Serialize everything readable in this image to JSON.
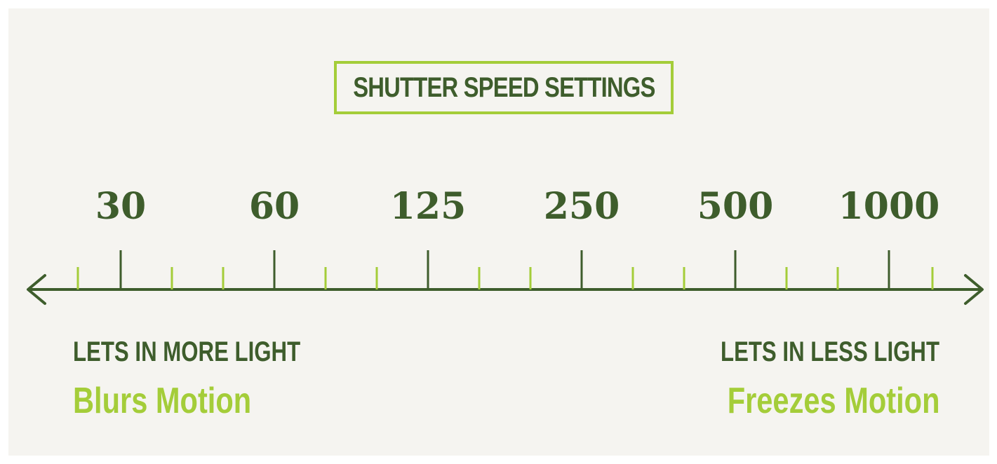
{
  "title": "SHUTTER SPEED SETTINGS",
  "scale": {
    "speeds": [
      "30",
      "60",
      "125",
      "250",
      "500",
      "1000"
    ],
    "minor_ticks_between": 2
  },
  "left_end": {
    "light": "LETS IN MORE LIGHT",
    "motion": "Blurs Motion"
  },
  "right_end": {
    "light": "LETS IN LESS LIGHT",
    "motion": "Freezes Motion"
  },
  "colors": {
    "dark_green": "#3e5d2c",
    "lime_green": "#a4cd39",
    "background": "#f5f4f0"
  }
}
